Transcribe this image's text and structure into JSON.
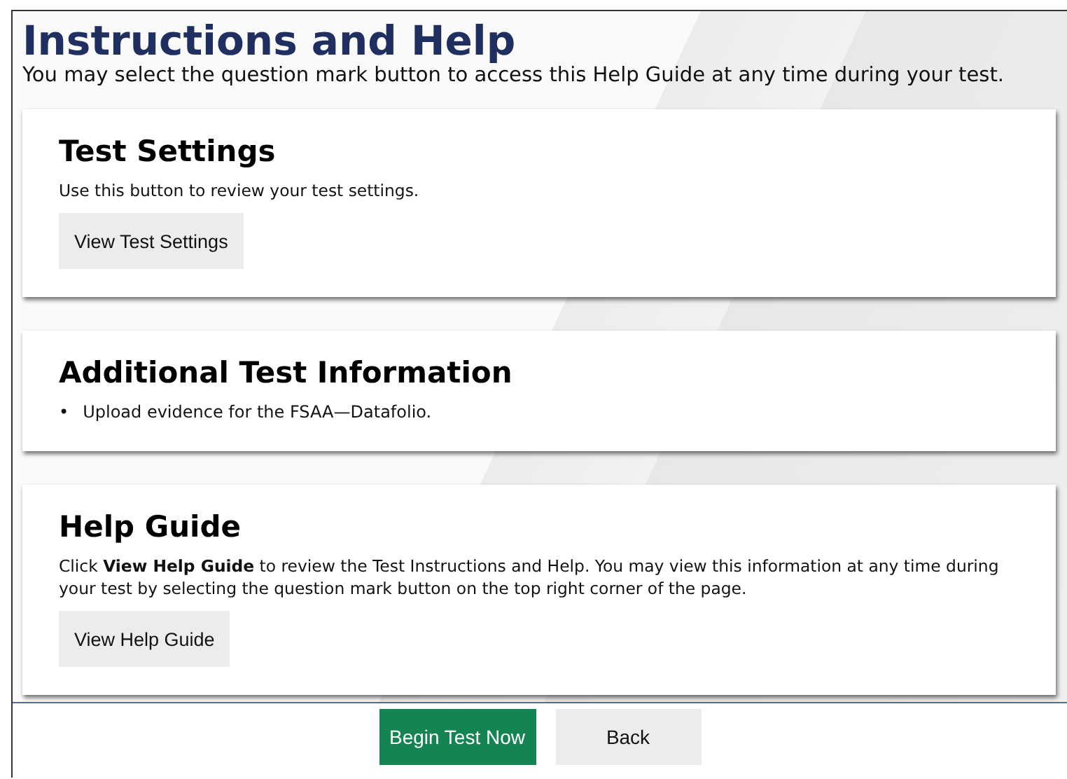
{
  "header": {
    "title": "Instructions and Help",
    "subtitle": "You may select the question mark button to access this Help Guide at any time during your test."
  },
  "cards": [
    {
      "kind": "button",
      "title": "Test Settings",
      "text": "Use this button to review your test settings.",
      "button": "View Test Settings"
    },
    {
      "kind": "list",
      "title": "Additional Test Information",
      "bullet": "•",
      "items": [
        "Upload evidence for the FSAA—Datafolio."
      ]
    },
    {
      "kind": "button",
      "title": "Help Guide",
      "text": "Click **View Help Guide** to review the Test Instructions and Help. You may view this information at any time during your test by selecting the question mark button on the top right corner of the page.",
      "button": "View Help Guide"
    }
  ],
  "footer": {
    "buttons": [
      {
        "label": "Begin Test Now",
        "kind": "primary"
      },
      {
        "label": "Back",
        "kind": "secondary"
      }
    ]
  }
}
